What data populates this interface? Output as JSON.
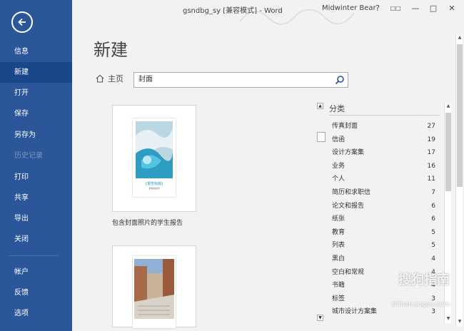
{
  "titlebar": {
    "doc_title": "gsndbg_sy [兼容模式] - Word",
    "user": "Midwinter Bear",
    "help": "?",
    "restore": "□□",
    "minimize": "—",
    "maximize": "□",
    "close": "✕"
  },
  "sidebar": {
    "items": [
      {
        "label": "信息"
      },
      {
        "label": "新建"
      },
      {
        "label": "打开"
      },
      {
        "label": "保存"
      },
      {
        "label": "另存为"
      },
      {
        "label": "历史记录"
      },
      {
        "label": "打印"
      },
      {
        "label": "共享"
      },
      {
        "label": "导出"
      },
      {
        "label": "关闭"
      },
      {
        "label": "帐户"
      },
      {
        "label": "反馈"
      },
      {
        "label": "选项"
      }
    ]
  },
  "main": {
    "title": "新建",
    "home_label": "主页",
    "search_value": "封面"
  },
  "templates": [
    {
      "caption": "包含封面照片的学生报告",
      "inner_title": "[报告标题]",
      "inner_sub": "报告副标题"
    },
    {
      "caption": ""
    }
  ],
  "categories": {
    "header": "分类",
    "items": [
      {
        "name": "传真封面",
        "count": "27"
      },
      {
        "name": "信函",
        "count": "19"
      },
      {
        "name": "设计方案集",
        "count": "17"
      },
      {
        "name": "业务",
        "count": "16"
      },
      {
        "name": "个人",
        "count": "11"
      },
      {
        "name": "简历和求职信",
        "count": "7"
      },
      {
        "name": "论文和报告",
        "count": "6"
      },
      {
        "name": "纸张",
        "count": "6"
      },
      {
        "name": "教育",
        "count": "5"
      },
      {
        "name": "列表",
        "count": "5"
      },
      {
        "name": "黑白",
        "count": "4"
      },
      {
        "name": "空白和常规",
        "count": "4"
      },
      {
        "name": "书籍",
        "count": "4"
      },
      {
        "name": "标签",
        "count": "3"
      },
      {
        "name": "城市设计方案集",
        "count": "3"
      }
    ]
  },
  "watermark": {
    "text": "搜狗指南",
    "url": "zhinan.sogou.com"
  },
  "colors": {
    "sidebar_bg": "#2b579a",
    "sidebar_active": "#19478a"
  }
}
